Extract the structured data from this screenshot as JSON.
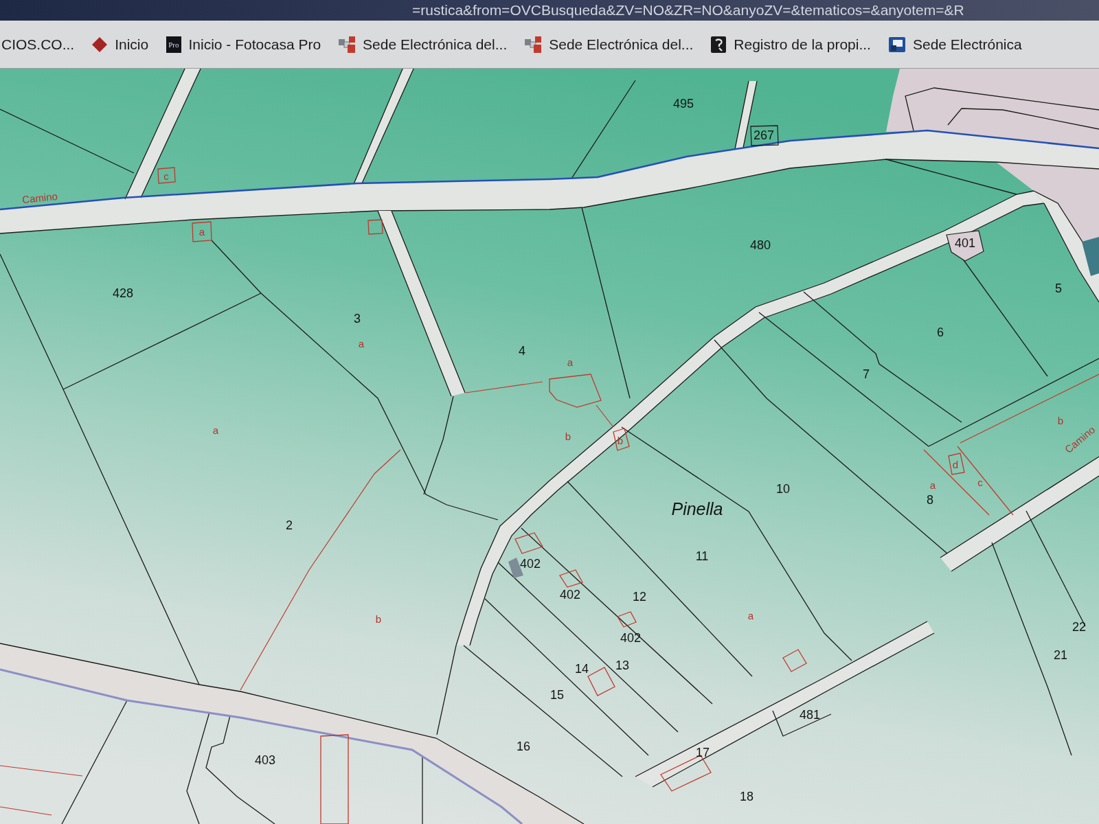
{
  "address_bar": {
    "url": "=rustica&from=OVCBusqueda&ZV=NO&ZR=NO&anyoZV=&tematicos=&anyotem=&R"
  },
  "bookmarks": [
    {
      "label": "CIOS.CO..."
    },
    {
      "label": "Inicio"
    },
    {
      "label": "Inicio - Fotocasa Pro",
      "logo_text": "Pro"
    },
    {
      "label": "Sede Electrónica del..."
    },
    {
      "label": "Sede Electrónica del..."
    },
    {
      "label": "Registro de la propi..."
    },
    {
      "label": "Sede Electrónica"
    }
  ],
  "map": {
    "labels": [
      {
        "text": "495",
        "kind": "parcel"
      },
      {
        "text": "267",
        "kind": "parcel"
      },
      {
        "text": "Camino",
        "kind": "road"
      },
      {
        "text": "c",
        "kind": "subparcel"
      },
      {
        "text": "a",
        "kind": "subparcel"
      },
      {
        "text": "428",
        "kind": "parcel"
      },
      {
        "text": "480",
        "kind": "parcel"
      },
      {
        "text": "401",
        "kind": "parcel"
      },
      {
        "text": "5",
        "kind": "parcel"
      },
      {
        "text": "3",
        "kind": "parcel"
      },
      {
        "text": "a",
        "kind": "subparcel"
      },
      {
        "text": "4",
        "kind": "parcel"
      },
      {
        "text": "a",
        "kind": "subparcel"
      },
      {
        "text": "6",
        "kind": "parcel"
      },
      {
        "text": "7",
        "kind": "parcel"
      },
      {
        "text": "a",
        "kind": "subparcel"
      },
      {
        "text": "b",
        "kind": "subparcel"
      },
      {
        "text": "Camino",
        "kind": "road"
      },
      {
        "text": "b",
        "kind": "subparcel"
      },
      {
        "text": "b",
        "kind": "subparcel"
      },
      {
        "text": "d",
        "kind": "subparcel"
      },
      {
        "text": "c",
        "kind": "subparcel"
      },
      {
        "text": "10",
        "kind": "parcel"
      },
      {
        "text": "a",
        "kind": "subparcel"
      },
      {
        "text": "8",
        "kind": "parcel"
      },
      {
        "text": "Pinella",
        "kind": "place"
      },
      {
        "text": "2",
        "kind": "parcel"
      },
      {
        "text": "11",
        "kind": "parcel"
      },
      {
        "text": "402",
        "kind": "parcel"
      },
      {
        "text": "402",
        "kind": "parcel"
      },
      {
        "text": "12",
        "kind": "parcel"
      },
      {
        "text": "b",
        "kind": "subparcel"
      },
      {
        "text": "a",
        "kind": "subparcel"
      },
      {
        "text": "402",
        "kind": "parcel"
      },
      {
        "text": "22",
        "kind": "parcel"
      },
      {
        "text": "21",
        "kind": "parcel"
      },
      {
        "text": "14",
        "kind": "parcel"
      },
      {
        "text": "13",
        "kind": "parcel"
      },
      {
        "text": "15",
        "kind": "parcel"
      },
      {
        "text": "481",
        "kind": "parcel"
      },
      {
        "text": "403",
        "kind": "parcel"
      },
      {
        "text": "16",
        "kind": "parcel"
      },
      {
        "text": "17",
        "kind": "parcel"
      },
      {
        "text": "18",
        "kind": "parcel"
      }
    ]
  }
}
